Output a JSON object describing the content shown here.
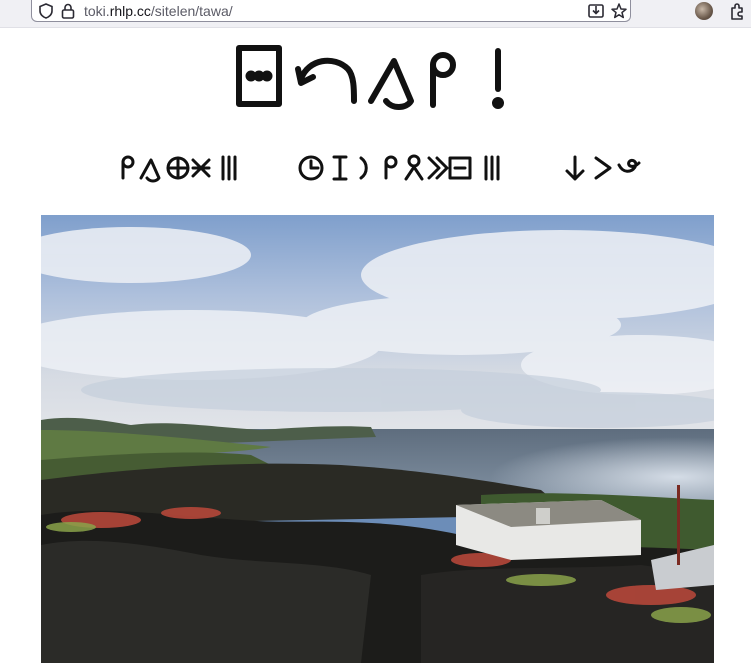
{
  "browser": {
    "url_prefix": "toki.",
    "url_domain": "rhlp.cc",
    "url_path": "/sitelen/tawa/"
  },
  "page": {
    "title_glyphs": [
      "pana",
      "tawa",
      "sina",
      "pi",
      "!"
    ],
    "nav": [
      {
        "glyphs": [
          "pi",
          "sina",
          "pi",
          "ko",
          "suli"
        ]
      },
      {
        "glyphs": [
          "tenpo",
          "lili",
          "pi",
          "mama",
          "tawa",
          "pana",
          "suli"
        ]
      },
      {
        "glyphs": [
          "anpa",
          "tawa",
          "sin"
        ]
      }
    ]
  },
  "colors": {
    "glyph": "#111111",
    "toolbar_bg": "#f0f0f4"
  }
}
